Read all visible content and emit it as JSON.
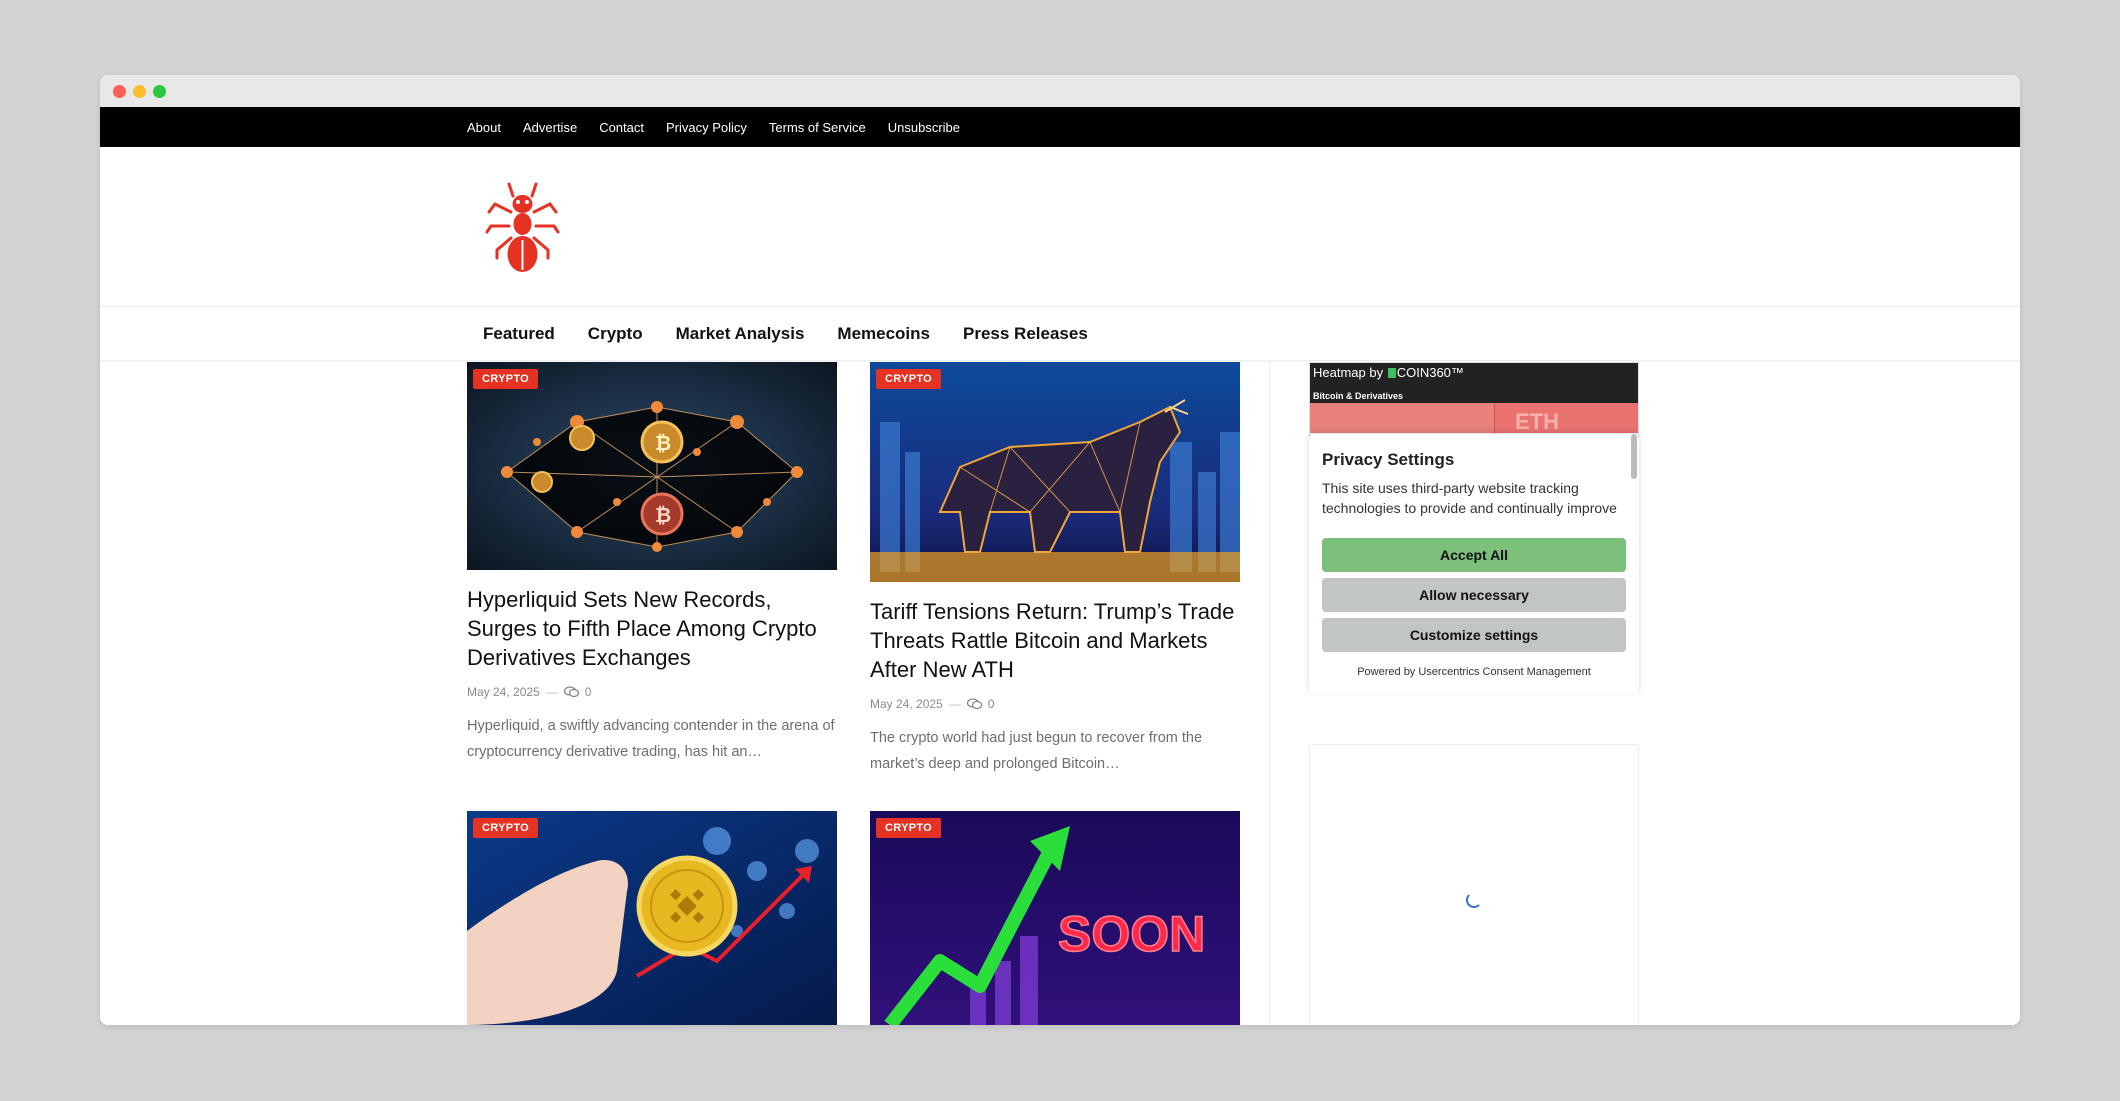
{
  "topbar": {
    "links": [
      "About",
      "Advertise",
      "Contact",
      "Privacy Policy",
      "Terms of Service",
      "Unsubscribe"
    ]
  },
  "mainnav": {
    "items": [
      "Featured",
      "Crypto",
      "Market Analysis",
      "Memecoins",
      "Press Releases"
    ]
  },
  "colors": {
    "accent": "#e53222",
    "accept": "#7cc07c",
    "neutral_btn": "#c2c6c2"
  },
  "articles": [
    {
      "category": "CRYPTO",
      "title": "Hyperliquid Sets New Records, Surges to Fifth Place Among Crypto Derivatives Exchanges",
      "date": "May 24, 2025",
      "comments": "0",
      "excerpt": "Hyperliquid, a swiftly advancing contender in the arena of cryptocurrency derivative trading, has hit an…"
    },
    {
      "category": "CRYPTO",
      "title": "Tariff Tensions Return: Trump’s Trade Threats Rattle Bitcoin and Markets After New ATH",
      "date": "May 24, 2025",
      "comments": "0",
      "excerpt": "The crypto world had just begun to recover from the market’s deep and prolonged Bitcoin…"
    },
    {
      "category": "CRYPTO"
    },
    {
      "category": "CRYPTO",
      "image_text": "SOON"
    }
  ],
  "heatmap": {
    "label": "Heatmap by",
    "brand": "COIN360™",
    "subtitle": "Bitcoin & Derivatives",
    "tile_text": "ETH"
  },
  "consent": {
    "title": "Privacy Settings",
    "text": "This site uses third-party website tracking technologies to provide and continually improve our services, and to display",
    "accept": "Accept All",
    "necessary": "Allow necessary",
    "customize": "Customize settings",
    "powered": "Powered by Usercentrics Consent Management"
  }
}
